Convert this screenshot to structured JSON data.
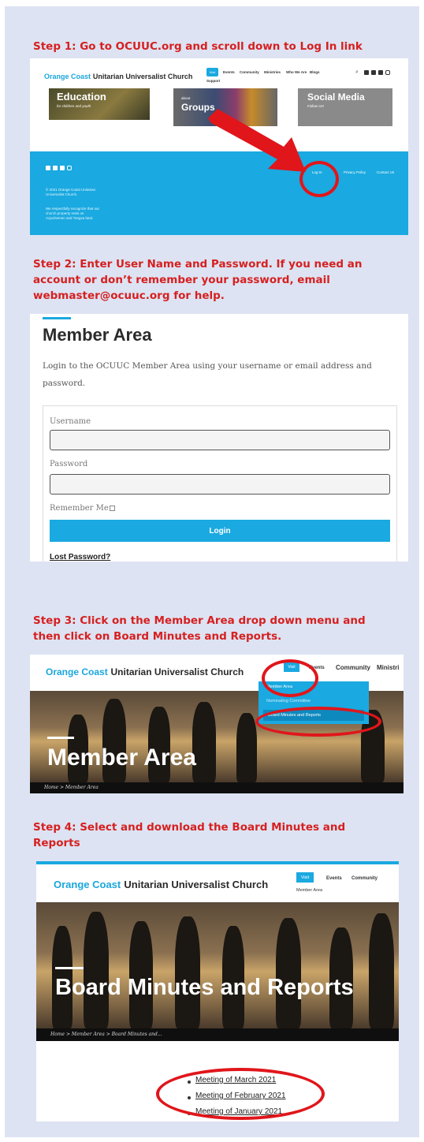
{
  "steps": {
    "s1": "Step 1: Go to OCUUC.org and scroll down to Log In link",
    "s2_l1": "Step 2: Enter User Name and Password. If you need an",
    "s2_l2": "account or don’t remember your password, email",
    "s2_l3": "webmaster@ocuuc.org for help.",
    "s3_l1": "Step 3: Click on the Member Area drop down menu and",
    "s3_l2": "then click on Board Minutes and Reports.",
    "s4_l1": "Step 4: Select and download the Board Minutes and",
    "s4_l2": "Reports"
  },
  "site": {
    "logo_orange": "Orange Coast",
    "logo_rest": "Unitarian Universalist Church",
    "nav": [
      "Visit",
      "Events",
      "Community",
      "Ministries",
      "Who We Are",
      "Blogs",
      "Support"
    ]
  },
  "shot1": {
    "tile1": "Education",
    "tile1_sub": "for children and youth",
    "tile2_small": "about",
    "tile2": "Groups",
    "tile3": "Social Media",
    "tile3_sub": "Follow Us!",
    "copyright": "© 2021 Orange Coast Unitarian Universalist Church.",
    "land_ack": "We respectfully recognize that our church property rests on Acjachemen and Tongva land.",
    "footer_links": [
      "Log In",
      "Privacy Policy",
      "Contact Us"
    ]
  },
  "shot2": {
    "title": "Member Area",
    "intro_l1": "Login to the OCUUC Member Area using your username or email address and",
    "intro_l2": "password.",
    "username_label": "Username",
    "password_label": "Password",
    "remember_label": "Remember Me",
    "login_label": "Login",
    "lost_password": "Lost Password?"
  },
  "shot3": {
    "nav_visit": "Visit",
    "nav_events": "Events",
    "nav_community": "Community",
    "nav_ministries": "Ministri",
    "dropdown": [
      "Member Area",
      "Board Minutes and Reports"
    ],
    "dropdown_mid": "Nominating Committee",
    "hero": "Member Area",
    "crumb": "Home  >  Member Area"
  },
  "shot4": {
    "nav_visit": "Visit",
    "nav_events": "Events",
    "nav_community": "Community",
    "nav_sub": "Member Area",
    "hero": "Board Minutes and Reports",
    "crumb": "Home  >  Member Area  >  Board Minutes and...",
    "meetings": [
      "Meeting of March 2021",
      "Meeting of February 2021",
      "Meeting of January 2021"
    ]
  },
  "colors": {
    "accent": "#1aa9e0",
    "annotation_red": "#e0161b",
    "step_text": "#d62020",
    "panel": "#dde3f2"
  }
}
